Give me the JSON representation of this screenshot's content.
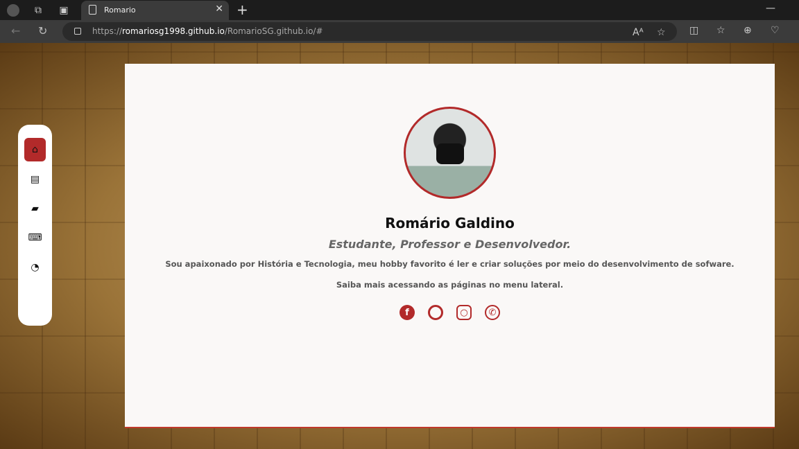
{
  "browser": {
    "tab_title": "Romario",
    "url_prefix": "https://",
    "url_domain": "romariosg1998.github.io",
    "url_path": "/RomarioSG.github.io/#"
  },
  "sidebar": {
    "items": [
      {
        "icon": "home-icon",
        "active": true
      },
      {
        "icon": "document-icon"
      },
      {
        "icon": "briefcase-icon"
      },
      {
        "icon": "laptop-code-icon"
      },
      {
        "icon": "rss-icon"
      }
    ]
  },
  "profile": {
    "name": "Romário Galdino",
    "role": "Estudante, Professor e Desenvolvedor.",
    "description": "Sou apaixonado por História e Tecnologia, meu hobby favorito é ler e criar soluções por meio do desenvolvimento de sofware.",
    "more": "Saiba mais acessando as páginas no menu lateral."
  },
  "social": [
    "facebook-icon",
    "github-icon",
    "instagram-icon",
    "whatsapp-icon"
  ],
  "colors": {
    "accent": "#b22a2a"
  }
}
